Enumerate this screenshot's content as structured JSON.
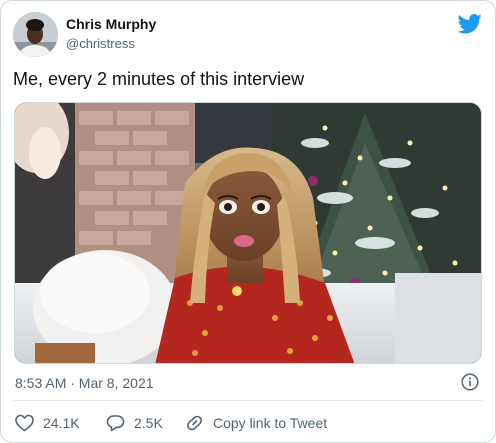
{
  "author": {
    "name": "Chris Murphy",
    "handle": "@christress"
  },
  "tweet": {
    "text": "Me, every 2 minutes of this interview"
  },
  "meta": {
    "timestamp": "8:53 AM · Mar 8, 2021"
  },
  "actions": {
    "likes": "24.1K",
    "replies": "2.5K",
    "copy_link": "Copy link to Tweet"
  },
  "icons": {
    "brand": "twitter-bird-icon",
    "info": "info-icon",
    "like": "heart-icon",
    "reply": "speech-bubble-icon",
    "copy": "link-icon"
  },
  "colors": {
    "brand": "#1d9bf0",
    "text": "#0f1419",
    "secondary": "#536471",
    "border": "#cfd9de"
  }
}
